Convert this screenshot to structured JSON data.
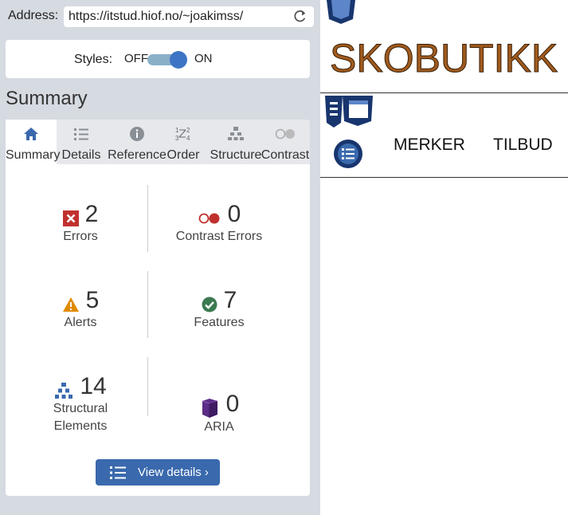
{
  "address_bar": {
    "label": "Address:",
    "url": "https://itstud.hiof.no/~joakimss/",
    "reload_icon": "reload-icon"
  },
  "styles_toggle": {
    "label": "Styles:",
    "off": "OFF",
    "on": "ON",
    "state": "on"
  },
  "summary_title": "Summary",
  "tabs": [
    {
      "label": "Summary",
      "icon": "home-icon",
      "active": true
    },
    {
      "label": "Details",
      "icon": "list-icon",
      "active": false
    },
    {
      "label": "Reference",
      "icon": "info-icon",
      "active": false
    },
    {
      "label": "Order",
      "icon": "order-icon",
      "active": false
    },
    {
      "label": "Structure",
      "icon": "structure-icon",
      "active": false
    },
    {
      "label": "Contrast",
      "icon": "contrast-icon",
      "active": false
    }
  ],
  "stats": {
    "errors": {
      "count": "2",
      "label": "Errors"
    },
    "contrast_errors": {
      "count": "0",
      "label": "Contrast Errors"
    },
    "alerts": {
      "count": "5",
      "label": "Alerts"
    },
    "features": {
      "count": "7",
      "label": "Features"
    },
    "structural": {
      "count": "14",
      "label1": "Structural",
      "label2": "Elements"
    },
    "aria": {
      "count": "0",
      "label": "ARIA"
    }
  },
  "view_details": "View details ›",
  "website": {
    "title": "SKOBUTIKK",
    "nav": [
      "MERKER",
      "TILBUD"
    ]
  },
  "colors": {
    "error": "#c0312e",
    "alert": "#e08a00",
    "feature": "#3b7a50",
    "structure": "#3a69ad",
    "aria": "#5b2d86",
    "accent": "#3a69ad"
  }
}
